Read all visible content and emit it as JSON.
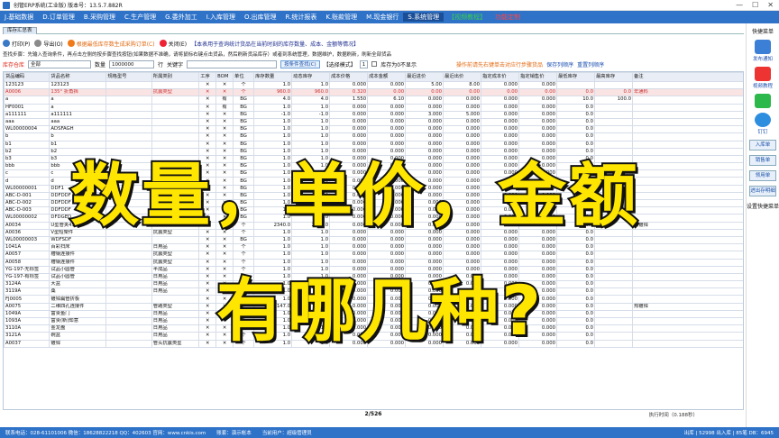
{
  "window": {
    "title": "创管ERP系统(工业版) 版本号：13.5.7.882R",
    "controls": [
      "—",
      "☐",
      "✕"
    ]
  },
  "menu": [
    "J.基础数据",
    "D.订单管理",
    "B.采购管理",
    "C.生产管理",
    "G.委外加工",
    "I.入库管理",
    "O.出库管理",
    "R.统计报表",
    "K.账款管理",
    "M.现金银行",
    "S.系统管理",
    "【视频教程】",
    "功能定制"
  ],
  "panel_tab": "库存汇总表",
  "toolbar": {
    "print": "打印(P)",
    "export": "导出(O)",
    "fetch_note": "根据最低库存数生成采购订单(C)",
    "close": "关闭(E)",
    "note": "【本表用于查询统计货品在当前时刻的库存数量、成本、金额等情况】"
  },
  "hint": "查找步骤：先输入查询条件，再点击左侧的按步骤查找按钮(如果数据不准确，请将鼠标右键点击货品，然后刷新货品库存）或者到系统管理，数据维护，数据刷新，刷新全部货品",
  "filter": {
    "warehouse_label": "库存仓库",
    "warehouse_value": "全部",
    "qty_label": "数量",
    "qty_value": "1000000",
    "row_label": "行",
    "keyword_label": "关键字",
    "search_btn": "按条件查找(C)",
    "mode_label": "【选择模式】",
    "mode_value": "1",
    "zero_label": "库存为0不显示",
    "link1": "操作前请先右键单击对应行步骤货品",
    "link2": "保存列顺序",
    "link3": "重置列顺序"
  },
  "table": {
    "headers": [
      "货品编码",
      "货品名称",
      "规格型号",
      "所属类别",
      "工序",
      "BOM",
      "单位",
      "库存数量",
      "动态库存",
      "成本价格",
      "成本金额",
      "最近进价",
      "最近出价",
      "指定成本价",
      "指定销售价",
      "最低库存",
      "最高库存",
      "备注"
    ],
    "rows": [
      [
        "123123",
        "123123",
        "",
        "",
        "✕",
        "✕",
        "个",
        "1.0",
        "1.0",
        "0.000",
        "0.000",
        "5.00",
        "8.00",
        "0.000",
        "0.000",
        "",
        "",
        ""
      ],
      [
        "A0006",
        "135° 折角挡",
        "",
        "抗震类型",
        "✕",
        "✕",
        "个",
        "960.0",
        "960.0",
        "0.320",
        "0.00",
        "0.00",
        "0.00",
        "0.00",
        "0.00",
        "0.0",
        "0.0",
        "年通料"
      ],
      [
        "a",
        "a",
        "",
        "",
        "✕",
        "有",
        "BG",
        "4.0",
        "4.0",
        "1.550",
        "6.10",
        "0.000",
        "0.000",
        "0.000",
        "0.000",
        "10.0",
        "100.0",
        ""
      ],
      [
        "HF0001",
        "a",
        "",
        "",
        "✕",
        "有",
        "BG",
        "1.0",
        "1.0",
        "0.000",
        "0.000",
        "0.000",
        "0.000",
        "0.000",
        "0.000",
        "0.0",
        "",
        ""
      ],
      [
        "a111111",
        "a111111",
        "",
        "",
        "✕",
        "✕",
        "BG",
        "-1.0",
        "-1.0",
        "0.000",
        "0.000",
        "3.000",
        "5.000",
        "0.000",
        "0.000",
        "0.0",
        "",
        ""
      ],
      [
        "aaa",
        "aaa",
        "",
        "",
        "✕",
        "✕",
        "BG",
        "1.0",
        "1.0",
        "0.000",
        "0.000",
        "0.000",
        "0.000",
        "0.000",
        "0.000",
        "0.0",
        "",
        ""
      ],
      [
        "WL00000004",
        "ADSFAGH",
        "",
        "",
        "✕",
        "✕",
        "BG",
        "1.0",
        "1.0",
        "0.000",
        "0.000",
        "0.000",
        "0.000",
        "0.000",
        "0.000",
        "0.0",
        "",
        ""
      ],
      [
        "b",
        "b",
        "",
        "",
        "✕",
        "✕",
        "BG",
        "1.0",
        "1.0",
        "0.000",
        "0.000",
        "0.000",
        "0.000",
        "0.000",
        "0.000",
        "0.0",
        "",
        ""
      ],
      [
        "b1",
        "b1",
        "",
        "",
        "✕",
        "✕",
        "BG",
        "1.0",
        "1.0",
        "0.000",
        "0.000",
        "0.000",
        "0.000",
        "0.000",
        "0.000",
        "0.0",
        "",
        ""
      ],
      [
        "b2",
        "b2",
        "",
        "",
        "✕",
        "✕",
        "BG",
        "1.0",
        "1.0",
        "0.000",
        "0.000",
        "0.000",
        "0.000",
        "0.000",
        "0.000",
        "0.0",
        "",
        ""
      ],
      [
        "b3",
        "b3",
        "",
        "",
        "✕",
        "✕",
        "BG",
        "1.0",
        "1.0",
        "0.000",
        "0.000",
        "0.000",
        "0.000",
        "0.000",
        "0.000",
        "0.0",
        "",
        ""
      ],
      [
        "bbb",
        "bbb",
        "",
        "",
        "✕",
        "✕",
        "BG",
        "1.0",
        "1.0",
        "0.000",
        "0.000",
        "0.000",
        "0.000",
        "0.000",
        "0.000",
        "0.0",
        "",
        ""
      ],
      [
        "c",
        "c",
        "",
        "",
        "✕",
        "✕",
        "BG",
        "1.0",
        "1.0",
        "0.000",
        "0.000",
        "0.000",
        "0.000",
        "0.000",
        "0.000",
        "0.0",
        "",
        ""
      ],
      [
        "d",
        "d",
        "",
        "",
        "✕",
        "✕",
        "BG",
        "1.0",
        "1.0",
        "0.000",
        "0.000",
        "0.000",
        "0.000",
        "0.000",
        "0.000",
        "0.0",
        "",
        ""
      ],
      [
        "WL00000001",
        "DDF1",
        "",
        "",
        "✕",
        "✕",
        "BG",
        "1.0",
        "1.0",
        "0.000",
        "0.000",
        "0.000",
        "0.000",
        "0.000",
        "0.000",
        "0.0",
        "",
        ""
      ],
      [
        "ABC-D-001",
        "DDFDDF",
        "",
        "",
        "✕",
        "✕",
        "BG",
        "1.0",
        "1.0",
        "0.000",
        "0.000",
        "0.000",
        "0.000",
        "0.000",
        "0.000",
        "0.0",
        "",
        ""
      ],
      [
        "ABC-D-002",
        "DDFDDF",
        "",
        "",
        "✕",
        "✕",
        "BG",
        "1.0",
        "1.0",
        "0.000",
        "0.000",
        "0.000",
        "0.000",
        "0.000",
        "0.000",
        "0.0",
        "",
        ""
      ],
      [
        "ABC-D-003",
        "DDFDDF",
        "",
        "",
        "✕",
        "✕",
        "BG",
        "1.0",
        "1.0",
        "0.000",
        "0.000",
        "0.000",
        "0.000",
        "0.000",
        "0.000",
        "0.0",
        "",
        ""
      ],
      [
        "WL00000002",
        "DFDGED",
        "",
        "",
        "✕",
        "✕",
        "BG",
        "1.0",
        "1.0",
        "0.000",
        "0.000",
        "0.000",
        "0.000",
        "0.000",
        "0.000",
        "0.0",
        "",
        ""
      ],
      [
        "A0034",
        "U型管夹45号",
        "",
        "管路类型",
        "✕",
        "✕",
        "个",
        "2340.0",
        "2340.0",
        "0.000",
        "0.000",
        "0.000",
        "0.000",
        "0.000",
        "0.000",
        "0.0",
        "",
        "热镀锌"
      ],
      [
        "A0036",
        "V型短架件",
        "",
        "抗震类型",
        "✕",
        "✕",
        "个",
        "1.0",
        "1.0",
        "0.000",
        "0.000",
        "0.000",
        "0.000",
        "0.000",
        "0.000",
        "0.0",
        "",
        ""
      ],
      [
        "WL00000003",
        "WDFSDF",
        "",
        "",
        "✕",
        "✕",
        "BG",
        "1.0",
        "1.0",
        "0.000",
        "0.000",
        "0.000",
        "0.000",
        "0.000",
        "0.000",
        "0.0",
        "",
        ""
      ],
      [
        "1041A",
        "百彩扫床",
        "",
        "日用品",
        "✕",
        "✕",
        "个",
        "1.0",
        "1.0",
        "0.000",
        "0.000",
        "0.000",
        "0.000",
        "0.000",
        "0.000",
        "0.0",
        "",
        ""
      ],
      [
        "A0057",
        "槽钢连接件",
        "",
        "抗震类型",
        "✕",
        "✕",
        "个",
        "1.0",
        "1.0",
        "0.000",
        "0.000",
        "0.000",
        "0.000",
        "0.000",
        "0.000",
        "0.0",
        "",
        ""
      ],
      [
        "A0058",
        "槽钢连接件",
        "",
        "抗震类型",
        "✕",
        "✕",
        "个",
        "1.0",
        "1.0",
        "0.000",
        "0.000",
        "0.000",
        "0.000",
        "0.000",
        "0.000",
        "0.0",
        "",
        ""
      ],
      [
        "YG-197-无标签",
        "试品小圆管",
        "",
        "半成品",
        "✕",
        "✕",
        "个",
        "1.0",
        "1.0",
        "0.000",
        "0.000",
        "0.000",
        "0.000",
        "0.000",
        "0.000",
        "0.0",
        "",
        ""
      ],
      [
        "YG-197-有标签",
        "试品小圆管",
        "",
        "日用品",
        "✕",
        "✕",
        "个",
        "1.0",
        "1.0",
        "0.000",
        "0.000",
        "0.000",
        "0.000",
        "0.000",
        "0.000",
        "0.0",
        "",
        ""
      ],
      [
        "3124A",
        "大盆",
        "",
        "日用品",
        "✕",
        "✕",
        "个",
        "1.0",
        "1.0",
        "0.000",
        "0.000",
        "0.000",
        "0.000",
        "0.000",
        "0.000",
        "0.0",
        "",
        ""
      ],
      [
        "3119A",
        "桑",
        "",
        "日用品",
        "✕",
        "✕",
        "个",
        "1.0",
        "1.0",
        "0.000",
        "0.000",
        "0.000",
        "0.000",
        "0.000",
        "0.000",
        "0.0",
        "",
        ""
      ],
      [
        "FJ0005",
        "镀锌扁管折板",
        "",
        "",
        "✕",
        "✕",
        "个",
        "1.0",
        "1.0",
        "0.000",
        "0.000",
        "0.000",
        "0.000",
        "0.000",
        "0.000",
        "0.0",
        "",
        ""
      ],
      [
        "A0075",
        "二维四孔连接件",
        "",
        "管路类型",
        "✕",
        "✕",
        "个",
        "147.0",
        "147.0",
        "0.000",
        "0.000",
        "0.000",
        "0.000",
        "0.000",
        "0.000",
        "0.0",
        "",
        "热镀锌"
      ],
      [
        "1049A",
        "富贵鱼门",
        "",
        "日用品",
        "✕",
        "✕",
        "个",
        "1.0",
        "1.0",
        "0.000",
        "0.000",
        "0.000",
        "0.000",
        "0.000",
        "0.000",
        "0.0",
        "",
        ""
      ],
      [
        "1093A",
        "富贵(新)知意",
        "",
        "日用品",
        "✕",
        "✕",
        "个",
        "1.0",
        "1.0",
        "0.000",
        "0.000",
        "0.000",
        "0.000",
        "0.000",
        "0.000",
        "0.0",
        "",
        ""
      ],
      [
        "3110A",
        "金龙盘",
        "",
        "日用品",
        "✕",
        "✕",
        "个",
        "1.0",
        "1.0",
        "0.000",
        "0.000",
        "0.000",
        "0.000",
        "0.000",
        "0.000",
        "0.0",
        "",
        ""
      ],
      [
        "3121A",
        "碗盆",
        "",
        "日用品",
        "✕",
        "✕",
        "个",
        "1.0",
        "1.0",
        "0.000",
        "0.000",
        "0.000",
        "0.000",
        "0.000",
        "0.000",
        "0.0",
        "",
        ""
      ],
      [
        "A0037",
        "镀锌",
        "",
        "管头抗震类型",
        "✕",
        "✕",
        "个",
        "1.0",
        "1.0",
        "0.000",
        "0.000",
        "0.000",
        "0.000",
        "0.000",
        "0.000",
        "0.0",
        "",
        ""
      ]
    ]
  },
  "pager": "2/526",
  "exec_time": "执行时间（0.188秒）",
  "statusbar": {
    "contact": "联系电话：028-61101006 微信：18628822218 QQ：402603 官网：www.cnkis.com",
    "account": "账套：演示帐本",
    "user": "当前用户：超级管理员",
    "stats": "出库 | 52998 出入库 | 85笔 DB：6945"
  },
  "sidebar": {
    "title": "快捷菜单",
    "items": [
      "发布通知",
      "视频教程",
      "",
      "钉钉"
    ],
    "buttons": [
      "入库单",
      "销售单",
      "领用单",
      "进出存明细"
    ],
    "bottom": "设置快捷菜单"
  },
  "overlay": {
    "line1": "数量，单价，金额",
    "line2": "有哪几种?"
  },
  "colors": {
    "menubar": "#2f73c9",
    "overlay_text": "#ffe600",
    "selected_row": "#f9e3e3"
  }
}
